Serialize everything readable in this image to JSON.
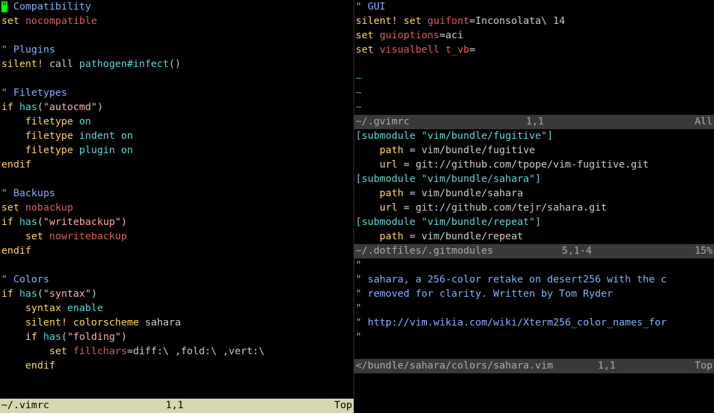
{
  "left": {
    "filename": "~/.vimrc",
    "cursor": "1,1",
    "scroll": "Top",
    "lines": [
      {
        "type": "comment",
        "text": "\" Compatibility",
        "cursor": true
      },
      {
        "tokens": [
          {
            "c": "keyword",
            "t": "set"
          },
          {
            "c": "",
            "t": " "
          },
          {
            "c": "option",
            "t": "nocompatible"
          }
        ]
      },
      {
        "blank": true
      },
      {
        "type": "comment",
        "text": "\" Plugins"
      },
      {
        "tokens": [
          {
            "c": "keyword",
            "t": "silent"
          },
          {
            "c": "special",
            "t": "!"
          },
          {
            "c": "",
            "t": " call "
          },
          {
            "c": "func",
            "t": "pathogen#infect"
          },
          {
            "c": "",
            "t": "()"
          }
        ]
      },
      {
        "blank": true
      },
      {
        "type": "comment",
        "text": "\" Filetypes"
      },
      {
        "tokens": [
          {
            "c": "keyword",
            "t": "if"
          },
          {
            "c": "",
            "t": " "
          },
          {
            "c": "func",
            "t": "has"
          },
          {
            "c": "",
            "t": "("
          },
          {
            "c": "string",
            "t": "\"autocmd\""
          },
          {
            "c": "",
            "t": ")"
          }
        ]
      },
      {
        "tokens": [
          {
            "c": "",
            "t": "    "
          },
          {
            "c": "keyword",
            "t": "filetype"
          },
          {
            "c": "",
            "t": " "
          },
          {
            "c": "identifier",
            "t": "on"
          }
        ]
      },
      {
        "tokens": [
          {
            "c": "",
            "t": "    "
          },
          {
            "c": "keyword",
            "t": "filetype"
          },
          {
            "c": "",
            "t": " "
          },
          {
            "c": "identifier",
            "t": "indent on"
          }
        ]
      },
      {
        "tokens": [
          {
            "c": "",
            "t": "    "
          },
          {
            "c": "keyword",
            "t": "filetype"
          },
          {
            "c": "",
            "t": " "
          },
          {
            "c": "identifier",
            "t": "plugin on"
          }
        ]
      },
      {
        "tokens": [
          {
            "c": "keyword",
            "t": "endif"
          }
        ]
      },
      {
        "blank": true
      },
      {
        "type": "comment",
        "text": "\" Backups"
      },
      {
        "tokens": [
          {
            "c": "keyword",
            "t": "set"
          },
          {
            "c": "",
            "t": " "
          },
          {
            "c": "option",
            "t": "nobackup"
          }
        ]
      },
      {
        "tokens": [
          {
            "c": "keyword",
            "t": "if"
          },
          {
            "c": "",
            "t": " "
          },
          {
            "c": "func",
            "t": "has"
          },
          {
            "c": "",
            "t": "("
          },
          {
            "c": "string",
            "t": "\"writebackup\""
          },
          {
            "c": "",
            "t": ")"
          }
        ]
      },
      {
        "tokens": [
          {
            "c": "",
            "t": "    "
          },
          {
            "c": "keyword",
            "t": "set"
          },
          {
            "c": "",
            "t": " "
          },
          {
            "c": "option",
            "t": "nowritebackup"
          }
        ]
      },
      {
        "tokens": [
          {
            "c": "keyword",
            "t": "endif"
          }
        ]
      },
      {
        "blank": true
      },
      {
        "type": "comment",
        "text": "\" Colors"
      },
      {
        "tokens": [
          {
            "c": "keyword",
            "t": "if"
          },
          {
            "c": "",
            "t": " "
          },
          {
            "c": "func",
            "t": "has"
          },
          {
            "c": "",
            "t": "("
          },
          {
            "c": "string",
            "t": "\"syntax\""
          },
          {
            "c": "",
            "t": ")"
          }
        ]
      },
      {
        "tokens": [
          {
            "c": "",
            "t": "    "
          },
          {
            "c": "keyword",
            "t": "syntax"
          },
          {
            "c": "",
            "t": " "
          },
          {
            "c": "identifier",
            "t": "enable"
          }
        ]
      },
      {
        "tokens": [
          {
            "c": "",
            "t": "    "
          },
          {
            "c": "keyword",
            "t": "silent"
          },
          {
            "c": "special",
            "t": "!"
          },
          {
            "c": "",
            "t": " "
          },
          {
            "c": "keyword",
            "t": "colorscheme"
          },
          {
            "c": "",
            "t": " sahara"
          }
        ]
      },
      {
        "tokens": [
          {
            "c": "",
            "t": "    "
          },
          {
            "c": "keyword",
            "t": "if"
          },
          {
            "c": "",
            "t": " "
          },
          {
            "c": "func",
            "t": "has"
          },
          {
            "c": "",
            "t": "("
          },
          {
            "c": "string",
            "t": "\"folding\""
          },
          {
            "c": "",
            "t": ")"
          }
        ]
      },
      {
        "tokens": [
          {
            "c": "",
            "t": "        "
          },
          {
            "c": "keyword",
            "t": "set"
          },
          {
            "c": "",
            "t": " "
          },
          {
            "c": "option",
            "t": "fillchars"
          },
          {
            "c": "",
            "t": "=diff:\\ ,fold:\\ ,vert:\\"
          }
        ]
      },
      {
        "tokens": [
          {
            "c": "",
            "t": "    "
          },
          {
            "c": "keyword",
            "t": "endif"
          }
        ]
      }
    ]
  },
  "right": {
    "sub1": {
      "filename": "~/.gvimrc",
      "cursor": "1,1",
      "scroll": "All",
      "lines": [
        {
          "type": "comment",
          "text": "\" GUI"
        },
        {
          "tokens": [
            {
              "c": "keyword",
              "t": "silent"
            },
            {
              "c": "special",
              "t": "!"
            },
            {
              "c": "",
              "t": " "
            },
            {
              "c": "keyword",
              "t": "set"
            },
            {
              "c": "",
              "t": " "
            },
            {
              "c": "option",
              "t": "guifont"
            },
            {
              "c": "",
              "t": "=Inconsolata\\ 14"
            }
          ]
        },
        {
          "tokens": [
            {
              "c": "keyword",
              "t": "set"
            },
            {
              "c": "",
              "t": " "
            },
            {
              "c": "option",
              "t": "guioptions"
            },
            {
              "c": "",
              "t": "=aci"
            }
          ]
        },
        {
          "tokens": [
            {
              "c": "keyword",
              "t": "set"
            },
            {
              "c": "",
              "t": " "
            },
            {
              "c": "option",
              "t": "visualbell"
            },
            {
              "c": "",
              "t": " "
            },
            {
              "c": "option",
              "t": "t_vb"
            },
            {
              "c": "",
              "t": "="
            }
          ]
        },
        {
          "blank": true
        },
        {
          "type": "tilde",
          "text": "~"
        },
        {
          "type": "tilde",
          "text": "~"
        },
        {
          "type": "tilde",
          "text": "~"
        }
      ]
    },
    "sub2": {
      "filename": "~/.dotfiles/.gitmodules",
      "cursor": "5,1-4",
      "scroll": "15%",
      "lines": [
        {
          "tokens": [
            {
              "c": "section",
              "t": "[submodule \"vim/bundle/fugitive\"]"
            }
          ]
        },
        {
          "tokens": [
            {
              "c": "",
              "t": "    "
            },
            {
              "c": "label",
              "t": "path"
            },
            {
              "c": "",
              "t": " = vim/bundle/fugitive"
            }
          ]
        },
        {
          "tokens": [
            {
              "c": "",
              "t": "    "
            },
            {
              "c": "label",
              "t": "url"
            },
            {
              "c": "",
              "t": " = git://github.com/tpope/vim-fugitive.git"
            }
          ]
        },
        {
          "tokens": [
            {
              "c": "section",
              "t": "[submodule \"vim/bundle/sahara\"]"
            }
          ]
        },
        {
          "tokens": [
            {
              "c": "",
              "t": "    "
            },
            {
              "c": "label",
              "t": "path"
            },
            {
              "c": "",
              "t": " = vim/bundle/sahara"
            }
          ]
        },
        {
          "tokens": [
            {
              "c": "",
              "t": "    "
            },
            {
              "c": "label",
              "t": "url"
            },
            {
              "c": "",
              "t": " = git://github.com/tejr/sahara.git"
            }
          ]
        },
        {
          "tokens": [
            {
              "c": "section",
              "t": "[submodule \"vim/bundle/repeat\"]"
            }
          ]
        },
        {
          "tokens": [
            {
              "c": "",
              "t": "    "
            },
            {
              "c": "label",
              "t": "path"
            },
            {
              "c": "",
              "t": " = vim/bundle/repeat"
            }
          ]
        }
      ]
    },
    "sub3": {
      "filename": "</bundle/sahara/colors/sahara.vim",
      "cursor": "1,1",
      "scroll": "Top",
      "lines": [
        {
          "type": "comment",
          "text": "\""
        },
        {
          "type": "comment",
          "text": "\" sahara, a 256-color retake on desert256 with the c"
        },
        {
          "type": "comment",
          "text": "\" removed for clarity. Written by Tom Ryder"
        },
        {
          "type": "comment",
          "text": "\""
        },
        {
          "type": "comment",
          "text": "\" http://vim.wikia.com/wiki/Xterm256_color_names_for"
        },
        {
          "type": "comment",
          "text": "\""
        },
        {
          "blank": true
        }
      ]
    }
  }
}
